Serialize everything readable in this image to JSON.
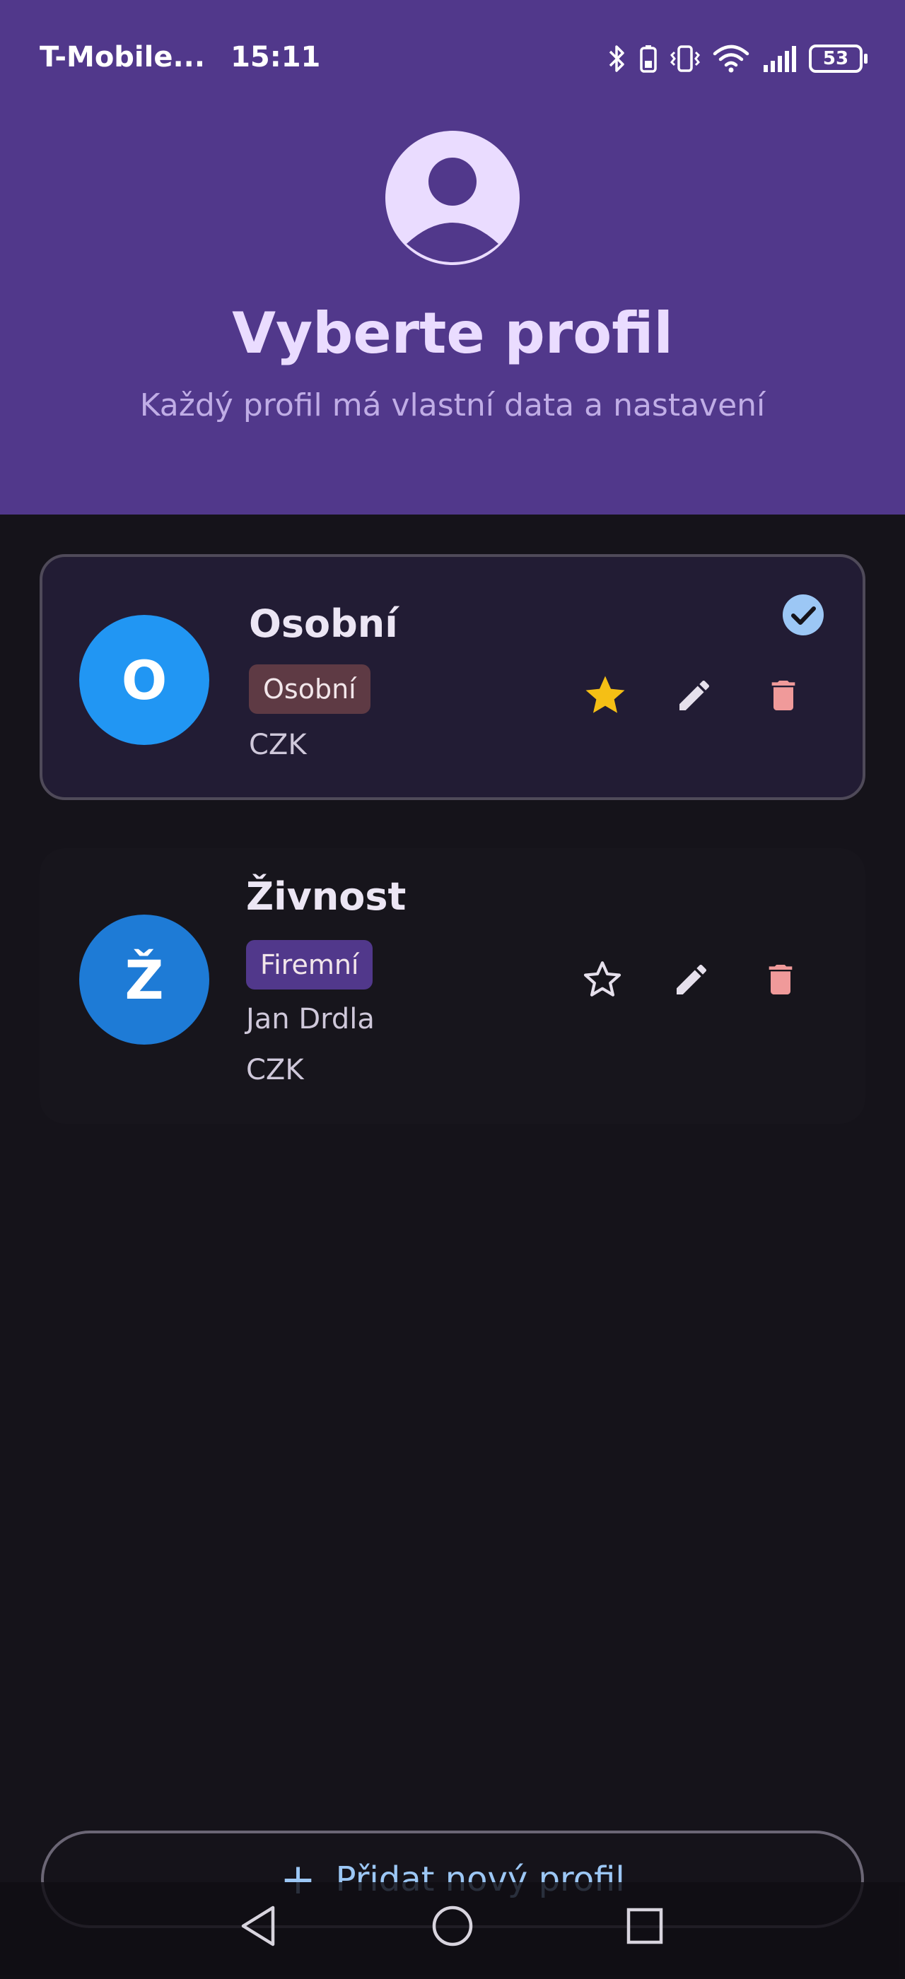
{
  "status_bar": {
    "carrier": "T-Mobile...",
    "time": "15:11",
    "battery": "53",
    "icons": [
      "bluetooth-icon",
      "battery-saver-icon",
      "vibrate-icon",
      "wifi-icon",
      "signal-icon",
      "battery-icon"
    ]
  },
  "header": {
    "title": "Vyberte profil",
    "subtitle": "Každý profil má vlastní data a nastavení",
    "icon": "account-circle-icon"
  },
  "profiles": [
    {
      "initial": "O",
      "name": "Osobní",
      "type": "Osobní",
      "owner": "",
      "currency": "CZK",
      "active": true,
      "favorite": true,
      "avatar_color": "#2196f3",
      "badge_color": "#5e3a44"
    },
    {
      "initial": "Ž",
      "name": "Živnost",
      "type": "Firemní",
      "owner": "Jan Drdla",
      "currency": "CZK",
      "active": false,
      "favorite": false,
      "avatar_color": "#1e7bd6",
      "badge_color": "#51388b"
    }
  ],
  "add_button": {
    "label": "Přidat nový profil",
    "icon": "plus-icon"
  },
  "nav_bar": {
    "icons": [
      "back-icon",
      "home-icon",
      "recents-icon"
    ]
  },
  "colors": {
    "header_bg": "#51388b",
    "page_bg": "#15131a",
    "accent_blue": "#9cc7f5",
    "star": "#f5bf15",
    "delete": "#f09a9a"
  }
}
